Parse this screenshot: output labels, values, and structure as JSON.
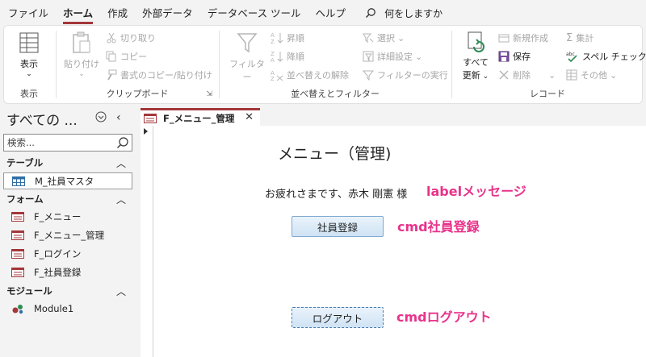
{
  "menu": {
    "tabs": [
      "ファイル",
      "ホーム",
      "作成",
      "外部データ",
      "データベース ツール",
      "ヘルプ"
    ],
    "active_index": 1,
    "tell_me": "何をしますか"
  },
  "ribbon": {
    "view": {
      "label": "表示",
      "group": "表示"
    },
    "clipboard": {
      "paste": "貼り付け",
      "cut": "切り取り",
      "copy": "コピー",
      "format_painter": "書式のコピー/貼り付け",
      "group": "クリップボード"
    },
    "sort_filter": {
      "filter": "フィルター",
      "ascending": "昇順",
      "descending": "降順",
      "remove_sort": "並べ替えの解除",
      "selection": "選択",
      "advanced": "詳細設定",
      "toggle_filter": "フィルターの実行",
      "group": "並べ替えとフィルター"
    },
    "records": {
      "refresh_line1": "すべて",
      "refresh_line2": "更新",
      "new": "新規作成",
      "save": "保存",
      "delete": "削除",
      "totals": "集計",
      "spelling": "スペル チェック",
      "more": "その他",
      "group": "レコード"
    }
  },
  "nav": {
    "title": "すべての ...",
    "search_placeholder": "検索...",
    "sections": [
      {
        "label": "テーブル",
        "items": [
          "M_社員マスタ"
        ]
      },
      {
        "label": "フォーム",
        "items": [
          "F_メニュー",
          "F_メニュー_管理",
          "F_ログイン",
          "F_社員登録"
        ]
      },
      {
        "label": "モジュール",
        "items": [
          "Module1"
        ]
      }
    ]
  },
  "document": {
    "tab_label": "F_メニュー_管理",
    "form_title": "メニュー（管理)",
    "message": "お疲れさまです、赤木 剛憲 様",
    "button_register": "社員登録",
    "button_logout": "ログアウト"
  },
  "annotations": {
    "message_label": "labelメッセージ",
    "register_label": "cmd社員登録",
    "logout_label": "cmdログアウト"
  },
  "colors": {
    "accent": "#a4373a",
    "annotation": "#e8338b",
    "button_border": "#7fa9cf"
  }
}
